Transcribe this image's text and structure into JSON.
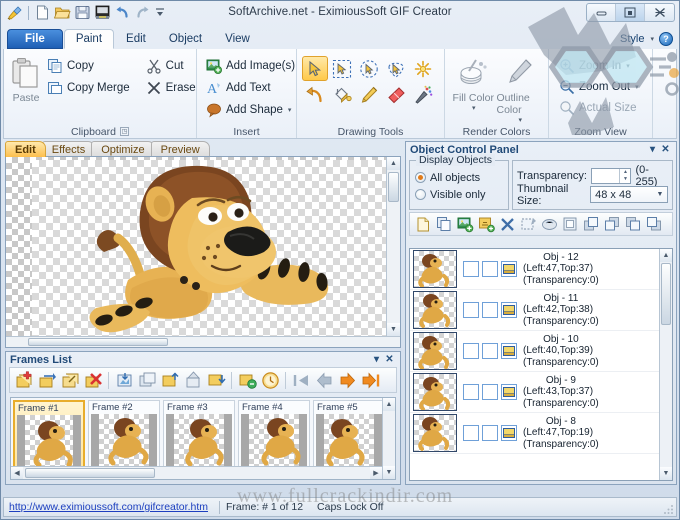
{
  "window": {
    "title": "SoftArchive.net - EximiousSoft GIF Creator",
    "controls": {
      "minimize": "—",
      "maximize": "❐",
      "close": "✕"
    }
  },
  "quick_access": [
    {
      "name": "app-icon",
      "tip": "EximiousSoft GIF Creator"
    },
    {
      "name": "new-icon",
      "tip": "New"
    },
    {
      "name": "open-icon",
      "tip": "Open"
    },
    {
      "name": "save-icon",
      "tip": "Save"
    },
    {
      "name": "export-icon",
      "tip": "Export"
    },
    {
      "name": "undo-icon",
      "tip": "Undo"
    },
    {
      "name": "redo-icon",
      "tip": "Redo"
    },
    {
      "name": "customize-qat-icon",
      "tip": "Customize Quick Access Toolbar"
    }
  ],
  "ribbon": {
    "tabs": [
      {
        "label": "File",
        "kind": "file"
      },
      {
        "label": "Paint",
        "kind": "active"
      },
      {
        "label": "Edit",
        "kind": "normal"
      },
      {
        "label": "Object",
        "kind": "normal"
      },
      {
        "label": "View",
        "kind": "normal"
      }
    ],
    "style_label": "Style",
    "help_label": "?",
    "groups": {
      "clipboard": {
        "label": "Clipboard",
        "paste": "Paste",
        "copy": "Copy",
        "copy_merge": "Copy Merge",
        "cut": "Cut",
        "erase": "Erase"
      },
      "insert": {
        "label": "Insert",
        "add_images": "Add Image(s)",
        "add_text": "Add Text",
        "add_shape": "Add Shape"
      },
      "drawing_tools": {
        "label": "Drawing Tools"
      },
      "render_colors": {
        "label": "Render Colors",
        "fill_color": "Fill Color",
        "outline_color": "Outline Color"
      },
      "zoom_view": {
        "label": "Zoom View",
        "zoom_in": "Zoom In",
        "zoom_out": "Zoom Out",
        "actual_size": "Actual Size"
      }
    }
  },
  "doc_tabs": [
    {
      "label": "Edit",
      "active": true
    },
    {
      "label": "Effects",
      "active": false
    },
    {
      "label": "Optimize",
      "active": false
    },
    {
      "label": "Preview",
      "active": false
    }
  ],
  "frames_panel": {
    "title": "Frames List",
    "collapse": "▾",
    "close": "✕",
    "frames": [
      {
        "label": "Frame #1",
        "selected": true
      },
      {
        "label": "Frame #2",
        "selected": false
      },
      {
        "label": "Frame #3",
        "selected": false
      },
      {
        "label": "Frame #4",
        "selected": false
      },
      {
        "label": "Frame #5",
        "selected": false
      }
    ],
    "tools": [
      "add-frame-icon",
      "insert-frame-icon",
      "edit-frame-icon",
      "delete-frame-icon",
      "import-frames-icon",
      "duplicate-frames-icon",
      "export-frames-icon",
      "move-up-icon",
      "move-down-icon",
      "frame-properties-icon",
      "frame-delay-icon",
      "first-frame-icon",
      "previous-frame-icon",
      "next-frame-icon",
      "last-frame-icon"
    ]
  },
  "object_panel": {
    "title": "Object Control Panel",
    "collapse": "▾",
    "close": "✕",
    "display_objects_label": "Display Objects",
    "all_objects": "All objects",
    "visible_only": "Visible only",
    "transparency_label": "Transparency:",
    "transparency_value": "",
    "transparency_range": "(0-255)",
    "thumbnail_size_label": "Thumbnail Size:",
    "thumbnail_size_value": "48 x 48",
    "tools": [
      "new-object-icon",
      "copy-object-icon",
      "add-image-object-icon",
      "add-text-object-icon",
      "delete-object-icon",
      "cut-object-icon",
      "merge-object-icon",
      "duplicate-object-icon",
      "bring-to-front-icon",
      "bring-forward-icon",
      "send-backward-icon",
      "send-to-back-icon"
    ],
    "objects": [
      {
        "name": "Obj - 12",
        "pos": "(Left:47,Top:37)",
        "transparency": "(Transparency:0)"
      },
      {
        "name": "Obj - 11",
        "pos": "(Left:42,Top:38)",
        "transparency": "(Transparency:0)"
      },
      {
        "name": "Obj - 10",
        "pos": "(Left:40,Top:39)",
        "transparency": "(Transparency:0)"
      },
      {
        "name": "Obj - 9",
        "pos": "(Left:43,Top:37)",
        "transparency": "(Transparency:0)"
      },
      {
        "name": "Obj - 8",
        "pos": "(Left:47,Top:19)",
        "transparency": "(Transparency:0)"
      }
    ]
  },
  "status_bar": {
    "link": "http://www.eximioussoft.com/gifcreator.htm",
    "frame_info": "Frame: # 1 of 12",
    "caps_lock": "Caps Lock Off"
  },
  "watermark": {
    "text": "www.fullcrackindir.com"
  },
  "colors": {
    "accent_blue": "#2b6fc9",
    "tab_active_orange": "#fdbf4d",
    "selection_yellow": "#ffc94a",
    "link_blue": "#1c3fbf",
    "panel_title": "#214a78"
  }
}
